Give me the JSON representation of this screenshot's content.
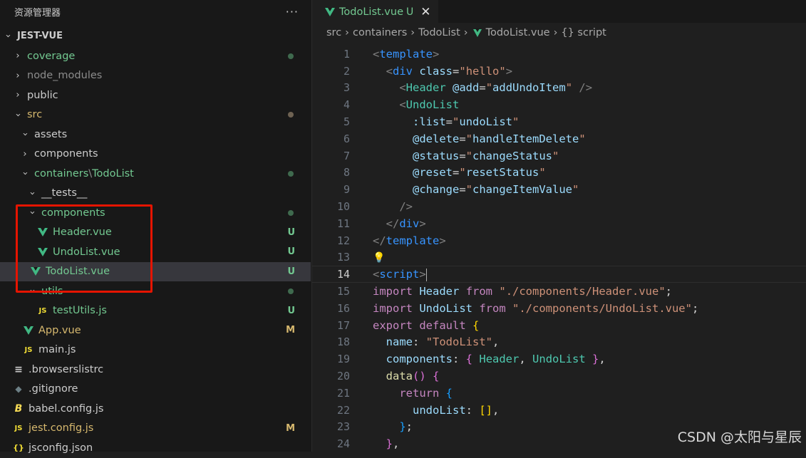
{
  "sidebar": {
    "title": "资源管理器",
    "more": "···",
    "root": "JEST-VUE",
    "items": [
      {
        "name": "coverage",
        "depth": 1,
        "kind": "folder",
        "open": false,
        "color": "#73c991",
        "dot": "#3f6a4e"
      },
      {
        "name": "node_modules",
        "depth": 1,
        "kind": "folder",
        "open": false,
        "color": "#8c8c8c"
      },
      {
        "name": "public",
        "depth": 1,
        "kind": "folder",
        "open": false,
        "color": "#cccccc"
      },
      {
        "name": "src",
        "depth": 1,
        "kind": "folder",
        "open": true,
        "color": "#d6b86e",
        "dot": "#6e6252"
      },
      {
        "name": "assets",
        "depth": 2,
        "kind": "folder",
        "open": true,
        "color": "#cccccc"
      },
      {
        "name": "components",
        "depth": 2,
        "kind": "folder",
        "open": false,
        "color": "#cccccc"
      },
      {
        "name": "containers",
        "extra": "TodoList",
        "depth": 2,
        "kind": "folder",
        "open": true,
        "color": "#73c991",
        "dot": "#3f6a4e"
      },
      {
        "name": "__tests__",
        "depth": 3,
        "kind": "folder",
        "open": true,
        "color": "#cccccc"
      },
      {
        "name": "components",
        "depth": 3,
        "kind": "folder",
        "open": true,
        "color": "#73c991",
        "dot": "#3f6a4e"
      },
      {
        "name": "Header.vue",
        "depth": 4,
        "kind": "vue",
        "color": "#73c991",
        "status": "U"
      },
      {
        "name": "UndoList.vue",
        "depth": 4,
        "kind": "vue",
        "color": "#73c991",
        "status": "U"
      },
      {
        "name": "TodoList.vue",
        "depth": 3,
        "kind": "vue",
        "color": "#73c991",
        "status": "U",
        "selected": true
      },
      {
        "name": "utils",
        "depth": 3,
        "kind": "folder",
        "open": true,
        "color": "#73c991",
        "dot": "#3f6a4e"
      },
      {
        "name": "testUtils.js",
        "depth": 4,
        "kind": "js",
        "color": "#73c991",
        "status": "U"
      },
      {
        "name": "App.vue",
        "depth": 2,
        "kind": "vue",
        "color": "#d6b86e",
        "status": "M"
      },
      {
        "name": "main.js",
        "depth": 2,
        "kind": "js",
        "color": "#cccccc"
      },
      {
        "name": ".browserslistrc",
        "depth": 1,
        "kind": "lines",
        "color": "#cccccc"
      },
      {
        "name": ".gitignore",
        "depth": 1,
        "kind": "git",
        "color": "#cccccc"
      },
      {
        "name": "babel.config.js",
        "depth": 1,
        "kind": "babel",
        "color": "#cccccc"
      },
      {
        "name": "jest.config.js",
        "depth": 1,
        "kind": "js",
        "color": "#d6b86e",
        "status": "M"
      },
      {
        "name": "jsconfig.json",
        "depth": 1,
        "kind": "json",
        "color": "#cccccc"
      }
    ]
  },
  "tab": {
    "name": "TodoList.vue",
    "mark": "U",
    "close": "✕"
  },
  "breadcrumb": [
    "src",
    "containers",
    "TodoList",
    "TodoList.vue",
    "{} script"
  ],
  "code": {
    "lines": [
      {
        "n": 1,
        "html": [
          [
            "t-br",
            "<"
          ],
          [
            "t-tag",
            "template"
          ],
          [
            "t-br",
            ">"
          ]
        ]
      },
      {
        "n": 2,
        "html": [
          [
            "t-pl",
            "  "
          ],
          [
            "t-br",
            "<"
          ],
          [
            "t-tag",
            "div"
          ],
          [
            "t-pl",
            " "
          ],
          [
            "t-attr",
            "class"
          ],
          [
            "t-pl",
            "="
          ],
          [
            "t-str",
            "\"hello\""
          ],
          [
            "t-br",
            ">"
          ]
        ]
      },
      {
        "n": 3,
        "html": [
          [
            "t-pl",
            "    "
          ],
          [
            "t-br",
            "<"
          ],
          [
            "t-tag2",
            "Header"
          ],
          [
            "t-pl",
            " "
          ],
          [
            "t-attr",
            "@add"
          ],
          [
            "t-pl",
            "="
          ],
          [
            "t-str",
            "\""
          ],
          [
            "t-attr",
            "addUndoItem"
          ],
          [
            "t-str",
            "\""
          ],
          [
            "t-pl",
            " "
          ],
          [
            "t-br",
            "/>"
          ]
        ]
      },
      {
        "n": 4,
        "html": [
          [
            "t-pl",
            "    "
          ],
          [
            "t-br",
            "<"
          ],
          [
            "t-tag2",
            "UndoList"
          ]
        ]
      },
      {
        "n": 5,
        "html": [
          [
            "t-pl",
            "      "
          ],
          [
            "t-attr",
            ":list"
          ],
          [
            "t-pl",
            "="
          ],
          [
            "t-str",
            "\""
          ],
          [
            "t-attr",
            "undoList"
          ],
          [
            "t-str",
            "\""
          ]
        ]
      },
      {
        "n": 6,
        "html": [
          [
            "t-pl",
            "      "
          ],
          [
            "t-attr",
            "@delete"
          ],
          [
            "t-pl",
            "="
          ],
          [
            "t-str",
            "\""
          ],
          [
            "t-attr",
            "handleItemDelete"
          ],
          [
            "t-str",
            "\""
          ]
        ]
      },
      {
        "n": 7,
        "html": [
          [
            "t-pl",
            "      "
          ],
          [
            "t-attr",
            "@status"
          ],
          [
            "t-pl",
            "="
          ],
          [
            "t-str",
            "\""
          ],
          [
            "t-attr",
            "changeStatus"
          ],
          [
            "t-str",
            "\""
          ]
        ]
      },
      {
        "n": 8,
        "html": [
          [
            "t-pl",
            "      "
          ],
          [
            "t-attr",
            "@reset"
          ],
          [
            "t-pl",
            "="
          ],
          [
            "t-str",
            "\""
          ],
          [
            "t-attr",
            "resetStatus"
          ],
          [
            "t-str",
            "\""
          ]
        ]
      },
      {
        "n": 9,
        "html": [
          [
            "t-pl",
            "      "
          ],
          [
            "t-attr",
            "@change"
          ],
          [
            "t-pl",
            "="
          ],
          [
            "t-str",
            "\""
          ],
          [
            "t-attr",
            "changeItemValue"
          ],
          [
            "t-str",
            "\""
          ]
        ]
      },
      {
        "n": 10,
        "html": [
          [
            "t-pl",
            "    "
          ],
          [
            "t-br",
            "/>"
          ]
        ]
      },
      {
        "n": 11,
        "html": [
          [
            "t-pl",
            "  "
          ],
          [
            "t-br",
            "</"
          ],
          [
            "t-tag",
            "div"
          ],
          [
            "t-br",
            ">"
          ]
        ]
      },
      {
        "n": 12,
        "html": [
          [
            "t-br",
            "</"
          ],
          [
            "t-tag",
            "template"
          ],
          [
            "t-br",
            ">"
          ]
        ]
      },
      {
        "n": 13,
        "html": [],
        "bulb": true
      },
      {
        "n": 14,
        "html": [
          [
            "t-br",
            "<"
          ],
          [
            "t-tag",
            "script"
          ],
          [
            "t-br",
            ">"
          ]
        ],
        "active": true
      },
      {
        "n": 15,
        "html": [
          [
            "t-kw2",
            "import"
          ],
          [
            "t-pl",
            " "
          ],
          [
            "t-attr",
            "Header"
          ],
          [
            "t-pl",
            " "
          ],
          [
            "t-kw2",
            "from"
          ],
          [
            "t-pl",
            " "
          ],
          [
            "t-str",
            "\"./components/Header.vue\""
          ],
          [
            "t-pl",
            ";"
          ]
        ]
      },
      {
        "n": 16,
        "html": [
          [
            "t-kw2",
            "import"
          ],
          [
            "t-pl",
            " "
          ],
          [
            "t-attr",
            "UndoList"
          ],
          [
            "t-pl",
            " "
          ],
          [
            "t-kw2",
            "from"
          ],
          [
            "t-pl",
            " "
          ],
          [
            "t-str",
            "\"./components/UndoList.vue\""
          ],
          [
            "t-pl",
            ";"
          ]
        ]
      },
      {
        "n": 17,
        "html": [
          [
            "t-kw2",
            "export"
          ],
          [
            "t-pl",
            " "
          ],
          [
            "t-kw2",
            "default"
          ],
          [
            "t-pl",
            " "
          ],
          [
            "t-y",
            "{"
          ]
        ]
      },
      {
        "n": 18,
        "html": [
          [
            "t-pl",
            "  "
          ],
          [
            "t-attr",
            "name"
          ],
          [
            "t-pl",
            ": "
          ],
          [
            "t-str",
            "\"TodoList\""
          ],
          [
            "t-pl",
            ","
          ]
        ]
      },
      {
        "n": 19,
        "html": [
          [
            "t-pl",
            "  "
          ],
          [
            "t-attr",
            "components"
          ],
          [
            "t-pl",
            ": "
          ],
          [
            "t-p",
            "{"
          ],
          [
            "t-pl",
            " "
          ],
          [
            "t-cls",
            "Header"
          ],
          [
            "t-pl",
            ", "
          ],
          [
            "t-cls",
            "UndoList"
          ],
          [
            "t-pl",
            " "
          ],
          [
            "t-p",
            "}"
          ],
          [
            "t-pl",
            ","
          ]
        ]
      },
      {
        "n": 20,
        "html": [
          [
            "t-pl",
            "  "
          ],
          [
            "t-fn",
            "data"
          ],
          [
            "t-p",
            "()"
          ],
          [
            "t-pl",
            " "
          ],
          [
            "t-p",
            "{"
          ]
        ]
      },
      {
        "n": 21,
        "html": [
          [
            "t-pl",
            "    "
          ],
          [
            "t-kw2",
            "return"
          ],
          [
            "t-pl",
            " "
          ],
          [
            "t-b",
            "{"
          ]
        ]
      },
      {
        "n": 22,
        "html": [
          [
            "t-pl",
            "      "
          ],
          [
            "t-attr",
            "undoList"
          ],
          [
            "t-pl",
            ": "
          ],
          [
            "t-y",
            "[]"
          ],
          [
            "t-pl",
            ","
          ]
        ]
      },
      {
        "n": 23,
        "html": [
          [
            "t-pl",
            "    "
          ],
          [
            "t-b",
            "}"
          ],
          [
            "t-pl",
            ";"
          ]
        ]
      },
      {
        "n": 24,
        "html": [
          [
            "t-pl",
            "  "
          ],
          [
            "t-p",
            "}"
          ],
          [
            "t-pl",
            ","
          ]
        ]
      }
    ]
  },
  "watermark": "CSDN @太阳与星辰"
}
